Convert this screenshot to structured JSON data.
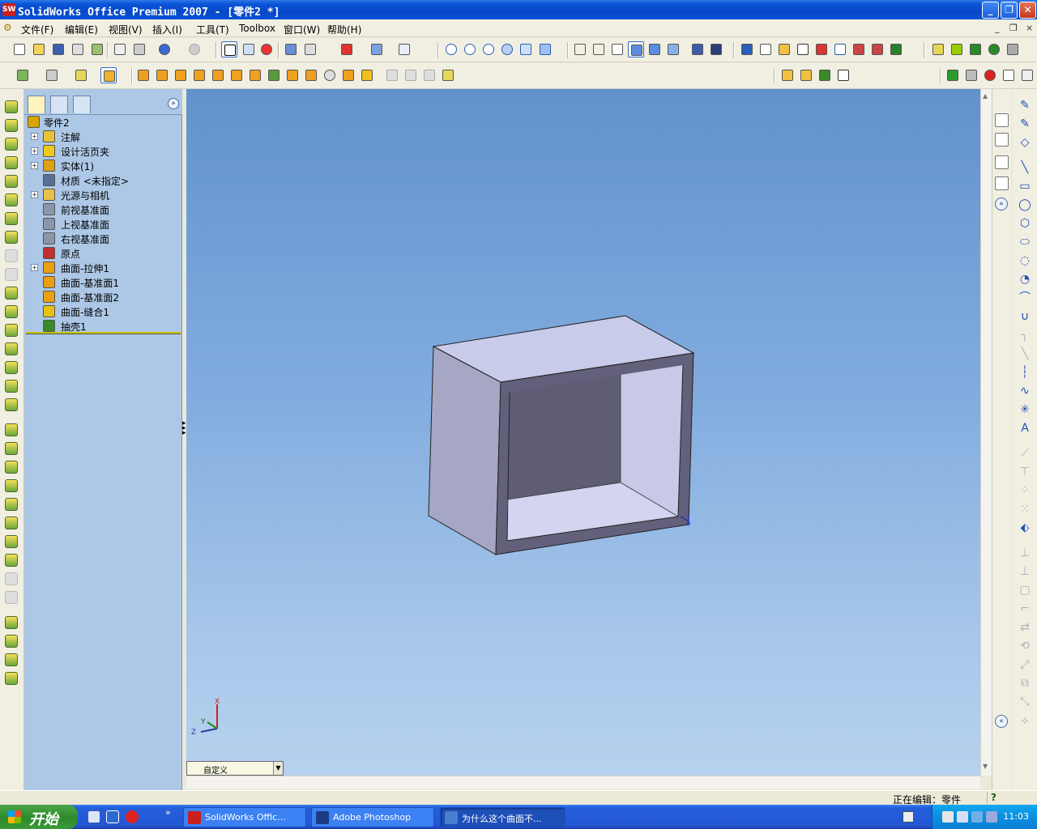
{
  "window": {
    "title": "SolidWorks Office Premium 2007 - [零件2 *]",
    "app_icon": "SW",
    "controls": {
      "minimize": "_",
      "restore": "❐",
      "close": "✕"
    }
  },
  "menu": {
    "items": [
      "文件(F)",
      "编辑(E)",
      "视图(V)",
      "插入(I)",
      "工具(T)",
      "Toolbox",
      "窗口(W)",
      "帮助(H)"
    ],
    "mdi": {
      "minimize": "_",
      "restore": "❐",
      "close": "×"
    }
  },
  "feature_tree": {
    "collapse": "»",
    "nodes": [
      {
        "label": "零件2",
        "expandable": false,
        "icon": "part-icon",
        "color": "#d9a400"
      },
      {
        "label": "注解",
        "expandable": true,
        "icon": "annotation-icon",
        "color": "#e8c23a"
      },
      {
        "label": "设计活页夹",
        "expandable": true,
        "icon": "design-binder-icon",
        "color": "#f0c81a"
      },
      {
        "label": "实体(1)",
        "expandable": true,
        "icon": "solid-bodies-icon",
        "color": "#e0a010"
      },
      {
        "label": "材质 <未指定>",
        "expandable": false,
        "icon": "material-icon",
        "color": "#5a6e9a"
      },
      {
        "label": "光源与相机",
        "expandable": true,
        "icon": "lights-cameras-icon",
        "color": "#e9c04a"
      },
      {
        "label": "前视基准面",
        "expandable": false,
        "icon": "plane-icon",
        "color": "#8a96aa"
      },
      {
        "label": "上视基准面",
        "expandable": false,
        "icon": "plane-icon",
        "color": "#8a96aa"
      },
      {
        "label": "右视基准面",
        "expandable": false,
        "icon": "plane-icon",
        "color": "#8a96aa"
      },
      {
        "label": "原点",
        "expandable": false,
        "icon": "origin-icon",
        "color": "#c03030"
      },
      {
        "label": "曲面-拉伸1",
        "expandable": true,
        "icon": "surface-extrude-icon",
        "color": "#e8a010"
      },
      {
        "label": "曲面-基准面1",
        "expandable": false,
        "icon": "planar-surface-icon",
        "color": "#e8a010"
      },
      {
        "label": "曲面-基准面2",
        "expandable": false,
        "icon": "planar-surface-icon",
        "color": "#e8a010"
      },
      {
        "label": "曲面-缝合1",
        "expandable": false,
        "icon": "knit-surface-icon",
        "color": "#e8c010"
      },
      {
        "label": "抽壳1",
        "expandable": false,
        "icon": "shell-icon",
        "color": "#3a8a2a"
      }
    ]
  },
  "viewport": {
    "view_orientation": "自定义",
    "triad": {
      "x": "X",
      "y": "Y",
      "z": "Z"
    },
    "colors": {
      "top_face": "#c9cbea",
      "side_face": "#a6a7c4",
      "front_rim": "#62607a",
      "inner_back": "#5f5c75",
      "inner_right": "#c7c9e6",
      "inner_bottom": "#d2d4f0"
    }
  },
  "status": {
    "text": "正在编辑：零件",
    "help": "?"
  },
  "taskbar": {
    "start_label": "开始",
    "overflow": "»",
    "buttons": [
      {
        "label": "SolidWorks Offic...",
        "active": false,
        "color": "#c8201e"
      },
      {
        "label": "Adobe Photoshop",
        "active": false,
        "color": "#1d3b82"
      },
      {
        "label": "为什么这个曲面不...",
        "active": true,
        "color": "#4a7fd0"
      }
    ],
    "clock": "11:03"
  }
}
